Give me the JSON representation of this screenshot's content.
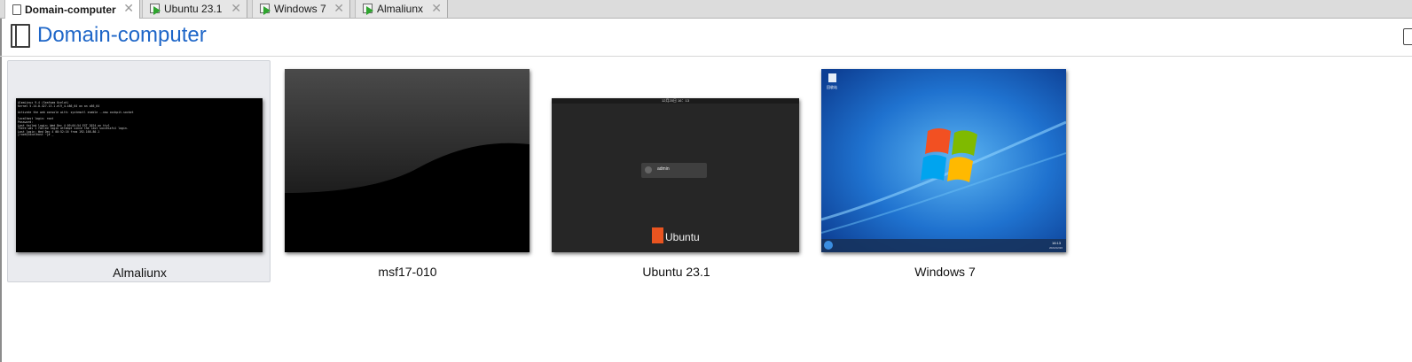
{
  "tabs": [
    {
      "label": "Domain-computer",
      "icon": "document-icon",
      "active": true
    },
    {
      "label": "Ubuntu 23.1",
      "icon": "vm-running-icon",
      "active": false
    },
    {
      "label": "Windows 7",
      "icon": "vm-running-icon",
      "active": false
    },
    {
      "label": "Almaliunx",
      "icon": "vm-running-icon",
      "active": false
    }
  ],
  "tab_close_glyph": "✕",
  "header": {
    "title": "Domain-computer",
    "icon": "document-icon"
  },
  "vms": [
    {
      "name": "Almaliunx",
      "screen": "linux-console",
      "selected": true,
      "console_lines": [
        "AlmaLinux 9.4 (Seafoam Ocelot)",
        "Kernel 5.14.0-427.13.1.el9_4.x86_64 on an x86_64",
        "",
        "Activate the web console with: systemctl enable --now cockpit.socket",
        "",
        "localhost login: root",
        "Password:",
        "Last failed login: Wed Dec  4 09:04:54 EST 2024 on tty1",
        "There was 1 failed login attempt since the last successful login.",
        "Last login: Wed Dec  4 08:52:16 from 192.168.80.1",
        "[root@localhost ~]# _"
      ]
    },
    {
      "name": "msf17-010",
      "screen": "dark-wallpaper",
      "selected": false
    },
    {
      "name": "Ubuntu 23.1",
      "screen": "ubuntu-login",
      "selected": false,
      "login_user": "admin",
      "brand": "Ubuntu",
      "topbar_time": "12月20日 16：13"
    },
    {
      "name": "Windows 7",
      "screen": "windows7-desktop",
      "selected": false,
      "desktop_icon_label": "回收站",
      "tray_time": "16:13",
      "tray_date": "2024/12/20"
    }
  ],
  "colors": {
    "accent": "#1e66c8",
    "vm_running": "#2fa52f",
    "ubuntu_orange": "#e95420"
  }
}
